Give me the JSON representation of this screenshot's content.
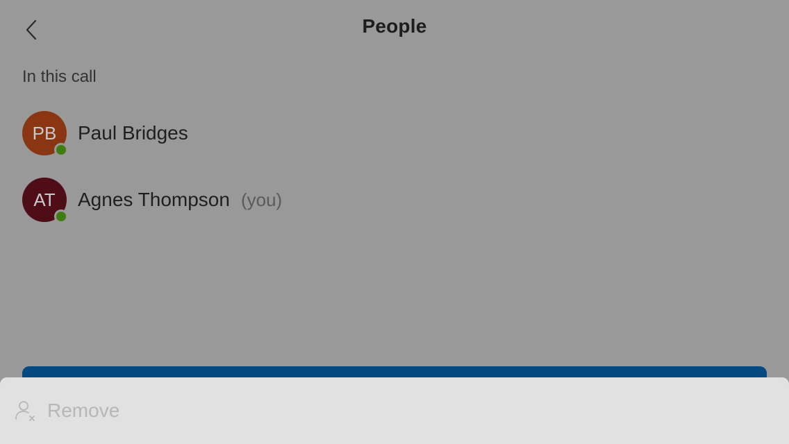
{
  "header": {
    "title": "People",
    "back_icon": "chevron-left-icon"
  },
  "section": {
    "label": "In this call"
  },
  "participants": [
    {
      "initials": "PB",
      "name": "Paul Bridges",
      "avatar_color": "#8a3612",
      "status": "available",
      "status_color": "#3f7d10"
    },
    {
      "initials": "AT",
      "name": "Agnes Thompson",
      "tag": "(you)",
      "avatar_color": "#4f0d17",
      "status": "available",
      "status_color": "#3f7d10"
    }
  ],
  "primary_bar": {
    "color": "#044a80"
  },
  "action_sheet": {
    "remove_label": "Remove",
    "remove_icon": "remove-person-icon"
  }
}
